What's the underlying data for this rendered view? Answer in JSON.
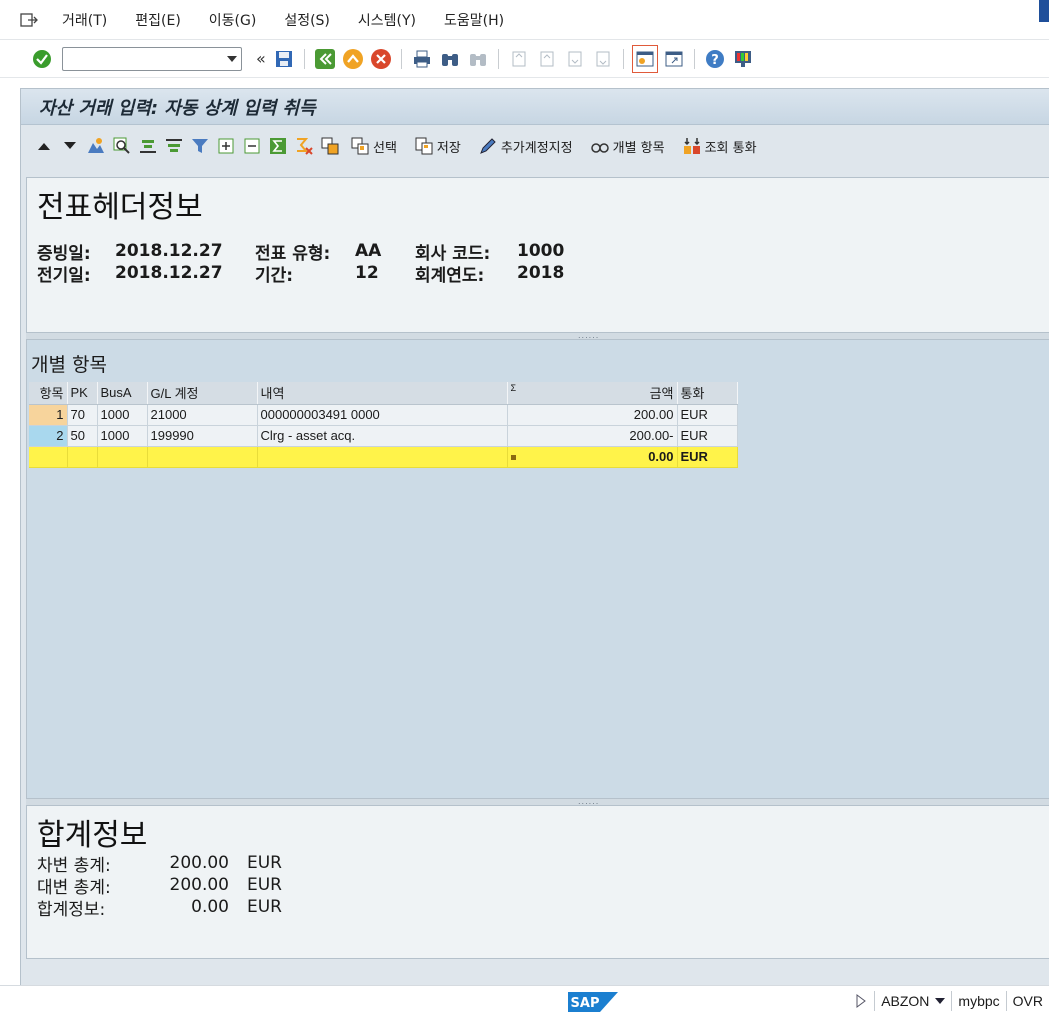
{
  "menubar": {
    "items": [
      "거래(T)",
      "편집(E)",
      "이동(G)",
      "설정(S)",
      "시스템(Y)",
      "도움말(H)"
    ]
  },
  "toolbar": {
    "command_value": ""
  },
  "screen": {
    "title": "자산 거래 입력: 자동 상계 입력 취득"
  },
  "app_toolbar": {
    "select_label": "선택",
    "save_label": "저장",
    "additional_account_label": "추가계정지정",
    "items_label": "개별 항목",
    "display_currency_label": "조회 통화"
  },
  "header": {
    "title": "전표헤더정보",
    "doc_date_label": "증빙일:",
    "doc_date": "2018.12.27",
    "posting_date_label": "전기일:",
    "posting_date": "2018.12.27",
    "doc_type_label": "전표 유형:",
    "doc_type": "AA",
    "period_label": "기간:",
    "period": "12",
    "company_code_label": "회사 코드:",
    "company_code": "1000",
    "fiscal_year_label": "회계연도:",
    "fiscal_year": "2018"
  },
  "items": {
    "title": "개별 항목",
    "columns": {
      "item": "항목",
      "pk": "PK",
      "busa": "BusA",
      "gl": "G/L 계정",
      "text": "내역",
      "sigma": "Σ",
      "amount": "금액",
      "currency": "통화"
    },
    "rows": [
      {
        "item": "1",
        "pk": "70",
        "busa": "1000",
        "gl": "21000",
        "text": "000000003491 0000",
        "amount": "200.00",
        "currency": "EUR"
      },
      {
        "item": "2",
        "pk": "50",
        "busa": "1000",
        "gl": "199990",
        "text": "Clrg - asset acq.",
        "amount": "200.00-",
        "currency": "EUR"
      }
    ],
    "total": {
      "amount": "0.00",
      "currency": "EUR"
    }
  },
  "totals": {
    "title": "합계정보",
    "debit_label": "차변 총계:",
    "debit_value": "200.00",
    "debit_currency": "EUR",
    "credit_label": "대변 총계:",
    "credit_value": "200.00",
    "credit_currency": "EUR",
    "balance_label": "합계정보:",
    "balance_value": "0.00",
    "balance_currency": "EUR"
  },
  "statusbar": {
    "logo_text": "SAP",
    "system": "ABZON",
    "client": "mybpc",
    "mode": "OVR"
  }
}
